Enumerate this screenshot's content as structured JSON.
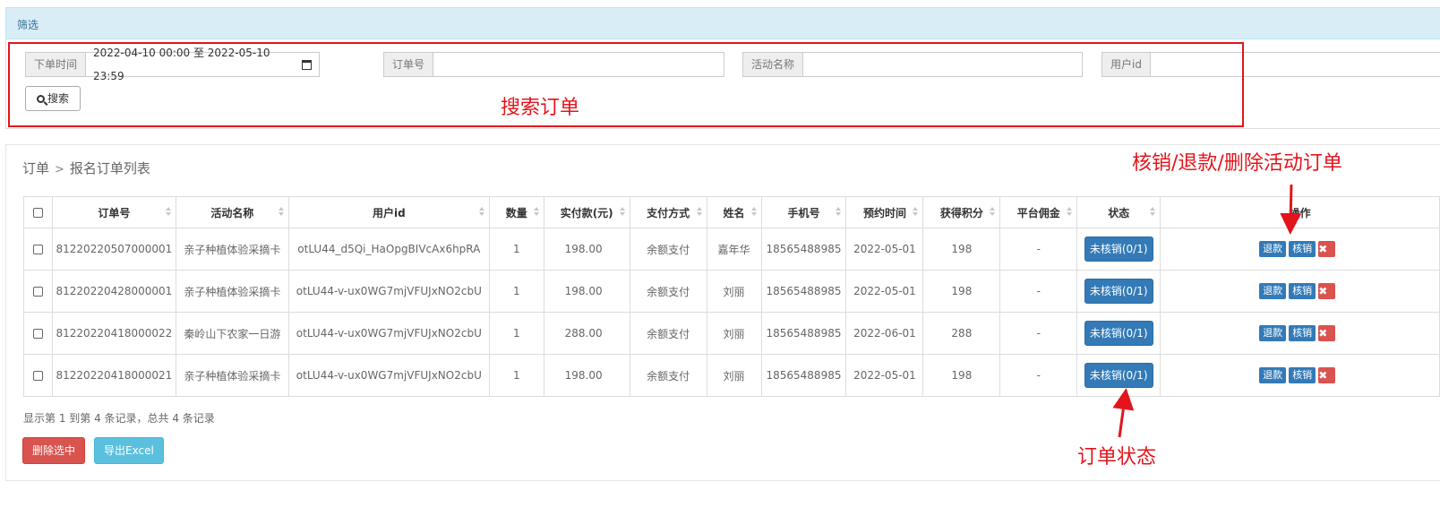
{
  "filter": {
    "header": "筛选",
    "order_time_label": "下单时间",
    "order_time_value": "2022-04-10 00:00 至 2022-05-10 23:59",
    "order_no_label": "订单号",
    "order_no_value": "",
    "activity_label": "活动名称",
    "activity_value": "",
    "user_id_label": "用户id",
    "user_id_value": "",
    "search_button": "搜索"
  },
  "annotations": {
    "search_orders": "搜索订单",
    "actions": "核销/退款/删除活动订单",
    "order_status": "订单状态",
    "color": "#e3141c"
  },
  "breadcrumb": {
    "root": "订单",
    "separator": ">",
    "current": "报名订单列表"
  },
  "table": {
    "headers": [
      "订单号",
      "活动名称",
      "用户id",
      "数量",
      "实付款(元)",
      "支付方式",
      "姓名",
      "手机号",
      "预约时间",
      "获得积分",
      "平台佣金",
      "状态",
      "操作"
    ],
    "rows": [
      {
        "order_no": "81220220507000001",
        "activity": "亲子种植体验采摘卡",
        "user_id": "otLU44_d5Qi_HaOpgBIVcAx6hpRA",
        "qty": "1",
        "paid": "198.00",
        "pay_method": "余额支付",
        "name": "嘉年华",
        "phone": "18565488985",
        "reserve_date": "2022-05-01",
        "points": "198",
        "commission": "-",
        "status": "未核销(0/1)"
      },
      {
        "order_no": "81220220428000001",
        "activity": "亲子种植体验采摘卡",
        "user_id": "otLU44-v-ux0WG7mjVFUJxNO2cbU",
        "qty": "1",
        "paid": "198.00",
        "pay_method": "余额支付",
        "name": "刘丽",
        "phone": "18565488985",
        "reserve_date": "2022-05-01",
        "points": "198",
        "commission": "-",
        "status": "未核销(0/1)"
      },
      {
        "order_no": "81220220418000022",
        "activity": "秦岭山下农家一日游",
        "user_id": "otLU44-v-ux0WG7mjVFUJxNO2cbU",
        "qty": "1",
        "paid": "288.00",
        "pay_method": "余额支付",
        "name": "刘丽",
        "phone": "18565488985",
        "reserve_date": "2022-06-01",
        "points": "288",
        "commission": "-",
        "status": "未核销(0/1)"
      },
      {
        "order_no": "81220220418000021",
        "activity": "亲子种植体验采摘卡",
        "user_id": "otLU44-v-ux0WG7mjVFUJxNO2cbU",
        "qty": "1",
        "paid": "198.00",
        "pay_method": "余额支付",
        "name": "刘丽",
        "phone": "18565488985",
        "reserve_date": "2022-05-01",
        "points": "198",
        "commission": "-",
        "status": "未核销(0/1)"
      }
    ],
    "actions": {
      "refund": "退款",
      "verify": "核销",
      "delete_icon": "close-icon"
    }
  },
  "summary": "显示第 1 到第 4 条记录，总共 4 条记录",
  "buttons": {
    "delete_selected": "删除选中",
    "export_excel": "导出Excel"
  }
}
